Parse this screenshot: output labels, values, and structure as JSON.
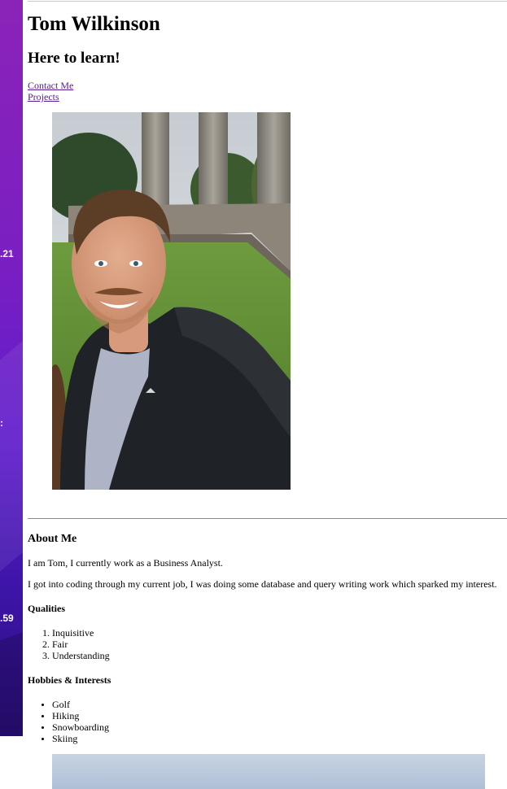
{
  "side": {
    "num1": ".21",
    "num2": ":",
    "num3": ".59"
  },
  "header": {
    "name": "Tom Wilkinson",
    "tagline": "Here to learn!"
  },
  "nav": {
    "contact": "Contact Me",
    "projects": "Projects"
  },
  "about": {
    "heading": "About Me",
    "para1": "I am Tom, I currently work as a Business Analyst.",
    "para2": "I got into coding through my current job, I was doing some database and query writing work which sparked my interest."
  },
  "qualities": {
    "heading": "Qualities",
    "items": [
      "Inquisitive",
      "Fair",
      "Understanding"
    ]
  },
  "hobbies": {
    "heading": "Hobbies & Interests",
    "items": [
      "Golf",
      "Hiking",
      "Snowboarding",
      "Skiing"
    ]
  }
}
